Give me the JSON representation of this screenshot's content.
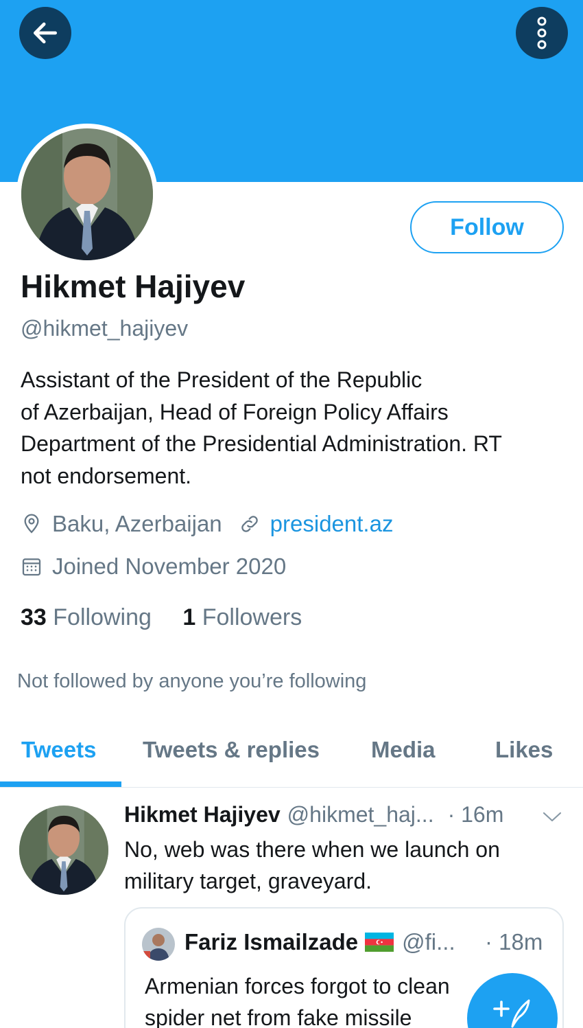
{
  "header": {
    "back_icon": "arrow-left-icon",
    "more_icon": "more-vertical-icon",
    "banner_color": "#1da1f2"
  },
  "profile": {
    "name": "Hikmet Hajiyev",
    "handle": "@hikmet_hajiyev",
    "bio_lines": [
      "Assistant of the President of the Republic",
      "of Azerbaijan, Head of Foreign Policy Affairs",
      "Department of the Presidential Administration.  RT",
      "not endorsement."
    ],
    "location": "Baku, Azerbaijan",
    "website": "president.az",
    "joined": "Joined November 2020",
    "following_count": "33",
    "following_label": "Following",
    "followers_count": "1",
    "followers_label": "Followers",
    "follow_button": "Follow",
    "not_followed_text": "Not followed by anyone you’re following"
  },
  "tabs": [
    {
      "label": "Tweets",
      "active": true
    },
    {
      "label": "Tweets & replies",
      "active": false
    },
    {
      "label": "Media",
      "active": false
    },
    {
      "label": "Likes",
      "active": false
    }
  ],
  "tweet": {
    "author_name": "Hikmet Hajiyev",
    "author_handle": "@hikmet_haj...",
    "time": "· 16m",
    "text_lines": [
      "No, web was there when we launch on",
      "military target, graveyard."
    ],
    "quoted": {
      "author_name": "Fariz Ismailzade",
      "flag": "azerbaijan-flag",
      "author_handle": "@fi...",
      "time": "· 18m",
      "text_lines": [
        "Armenian forces forgot to clean",
        "spider net from fake missile"
      ]
    }
  },
  "compose": {
    "icon": "compose-tweet-icon"
  },
  "colors": {
    "accent": "#1da1f2",
    "link": "#1b95e0",
    "muted": "#657786",
    "text": "#14171a",
    "header_button": "#0e3d5f"
  }
}
